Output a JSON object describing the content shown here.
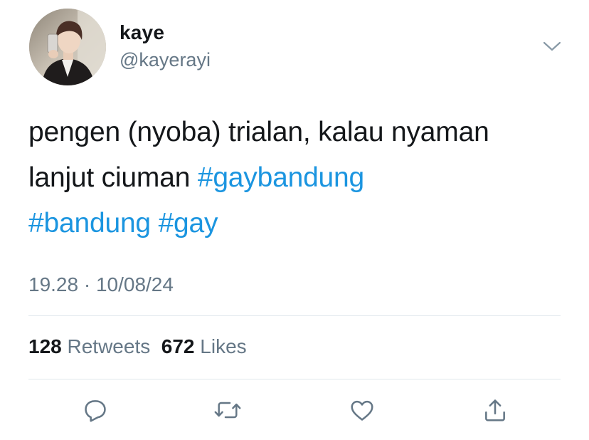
{
  "user": {
    "display_name": "kaye",
    "handle": "@kayerayi"
  },
  "tweet": {
    "text_line1": "pengen (nyoba) trialan, kalau nyaman",
    "text_line2_prefix": "lanjut ciuman ",
    "hashtags": [
      "#gaybandung",
      "#bandung",
      "#gay"
    ],
    "timestamp": "19.28 · 10/08/24"
  },
  "stats": {
    "retweets_count": "128",
    "retweets_label": "Retweets",
    "likes_count": "672",
    "likes_label": "Likes"
  },
  "icons": {
    "more": "chevron-down-icon",
    "reply": "reply-icon",
    "retweet": "retweet-icon",
    "like": "heart-icon",
    "share": "share-icon"
  },
  "colors": {
    "hashtag": "#1b95e0",
    "secondary_text": "#657786",
    "primary_text": "#14171a",
    "divider": "#e1e8ed"
  }
}
